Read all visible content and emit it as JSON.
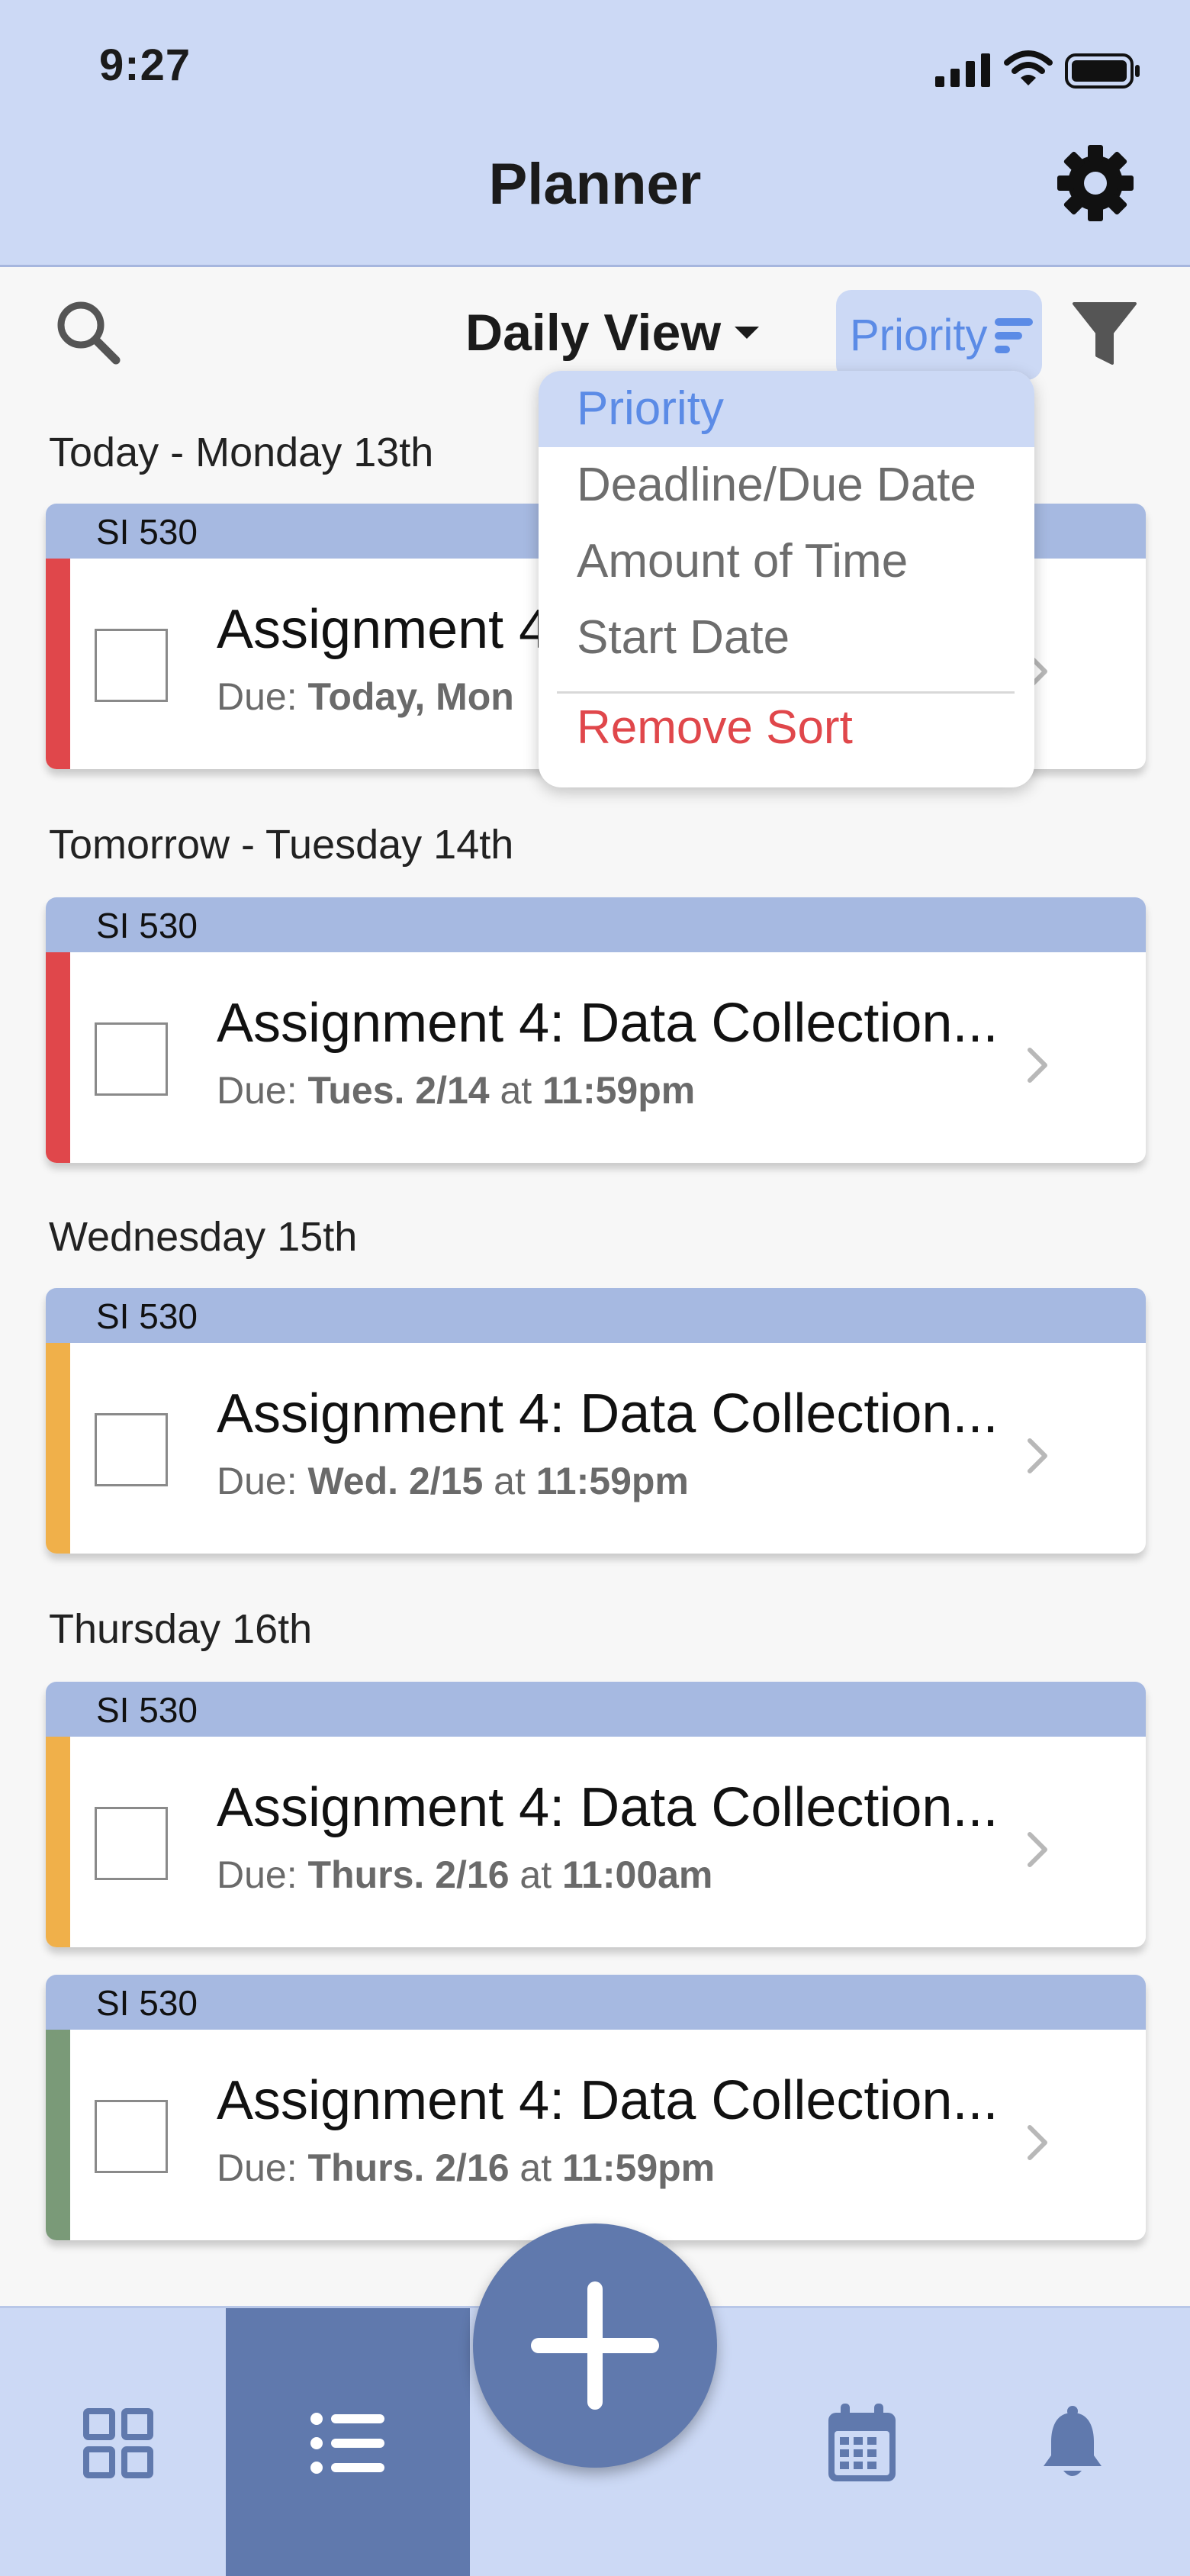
{
  "status_bar": {
    "time": "9:27"
  },
  "header": {
    "title": "Planner"
  },
  "toolbar": {
    "view_label": "Daily View",
    "sort_label": "Priority"
  },
  "sort_menu": {
    "options": [
      "Priority",
      "Deadline/Due Date",
      "Amount of Time",
      "Start Date"
    ],
    "selected": "Priority",
    "remove_label": "Remove Sort"
  },
  "sections": [
    {
      "label": "Today - Monday 13th",
      "cards": [
        {
          "course": "SI 530",
          "title": "Assignment 4",
          "due_prefix": "Due: ",
          "due_date": "Today, Mon",
          "due_mid": "",
          "due_time": "",
          "priority_color": "#e0474b"
        }
      ]
    },
    {
      "label": "Tomorrow - Tuesday 14th",
      "cards": [
        {
          "course": "SI 530",
          "title": "Assignment 4: Data Collection...",
          "due_prefix": "Due: ",
          "due_date": "Tues. 2/14",
          "due_mid": " at ",
          "due_time": "11:59pm",
          "priority_color": "#e0474b"
        }
      ]
    },
    {
      "label": "Wednesday 15th",
      "cards": [
        {
          "course": "SI 530",
          "title": "Assignment 4: Data Collection...",
          "due_prefix": "Due: ",
          "due_date": "Wed. 2/15",
          "due_mid": " at ",
          "due_time": "11:59pm",
          "priority_color": "#f0b04a"
        }
      ]
    },
    {
      "label": "Thursday 16th",
      "cards": [
        {
          "course": "SI 530",
          "title": "Assignment 4: Data Collection...",
          "due_prefix": "Due: ",
          "due_date": "Thurs. 2/16",
          "due_mid": " at ",
          "due_time": "11:00am",
          "priority_color": "#f0b04a"
        },
        {
          "course": "SI 530",
          "title": "Assignment 4: Data Collection...",
          "due_prefix": "Due: ",
          "due_date": "Thurs. 2/16",
          "due_mid": " at ",
          "due_time": "11:59pm",
          "priority_color": "#7a9a78"
        }
      ]
    }
  ],
  "bottom_nav": {
    "items": [
      "dashboard-grid-icon",
      "list-icon",
      "calendar-icon",
      "bell-icon"
    ],
    "active": "list-icon"
  },
  "colors": {
    "header_bg": "#ccd9f5",
    "accent": "#5b8be6",
    "nav_active": "#6079ad",
    "course_bar": "#a6b9e1",
    "danger": "#e0474b"
  }
}
